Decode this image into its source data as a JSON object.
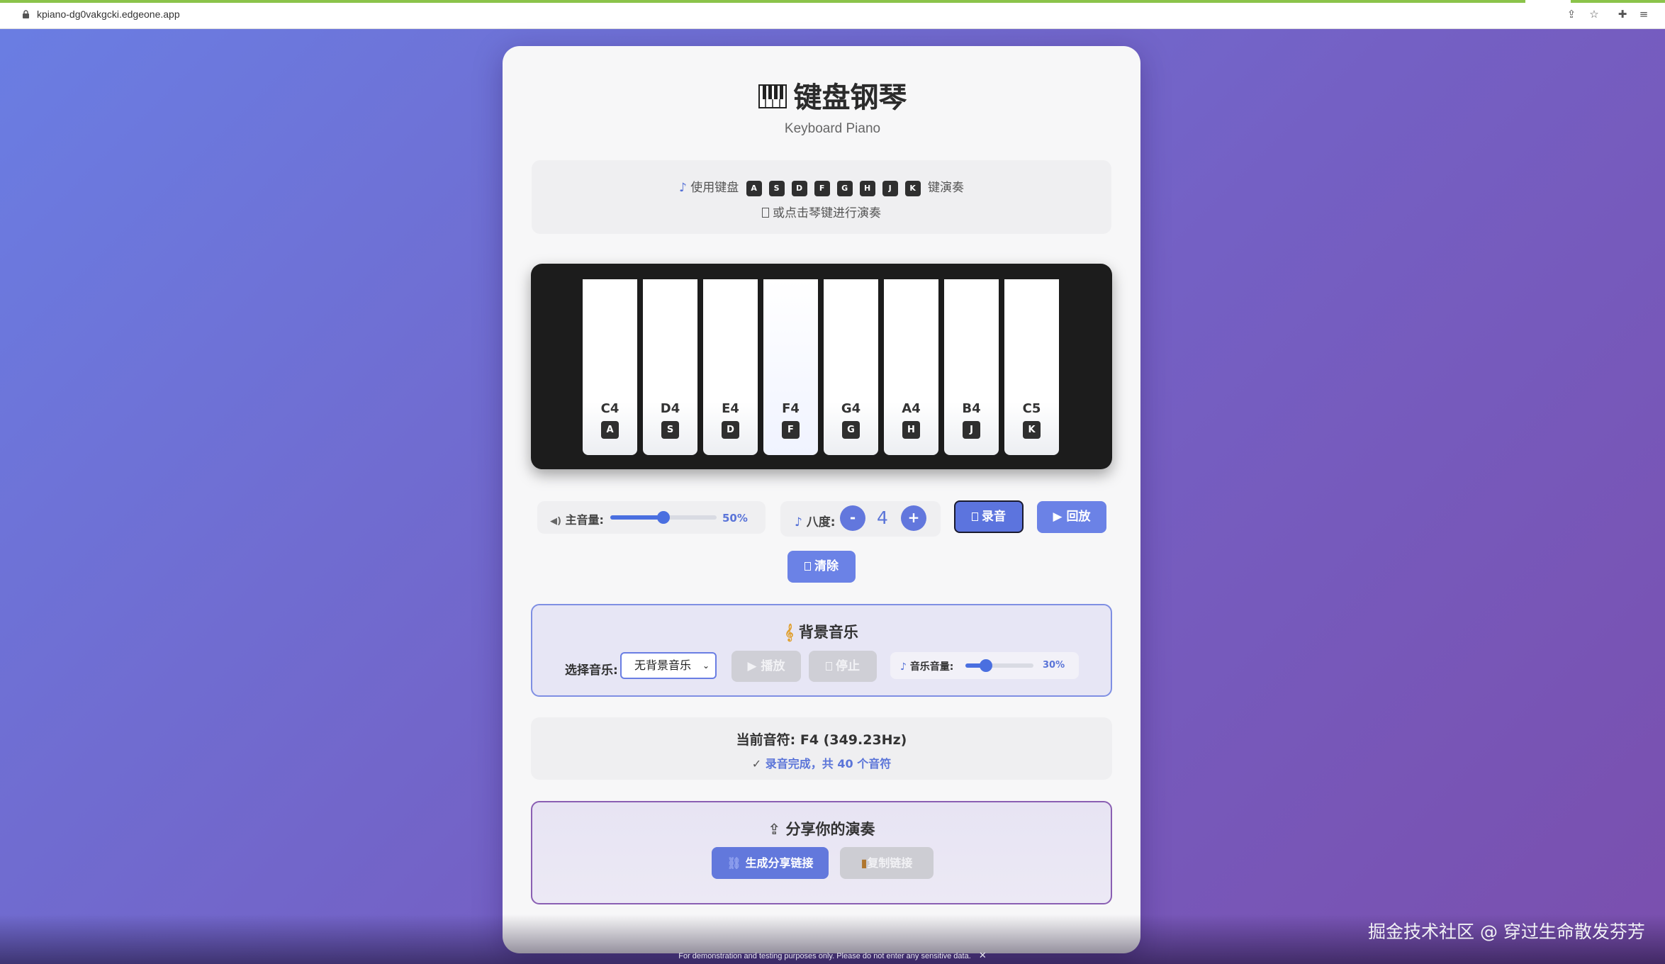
{
  "browser": {
    "url": "kpiano-dg0vakgcki.edgeone.app"
  },
  "header": {
    "title": "键盘钢琴",
    "subtitle": "Keyboard Piano"
  },
  "instructions": {
    "prefix": "使用键盘",
    "keys": [
      "A",
      "S",
      "D",
      "F",
      "G",
      "H",
      "J",
      "K"
    ],
    "suffix": "键演奏",
    "line2": "或点击琴键进行演奏"
  },
  "piano": {
    "keys": [
      {
        "note": "C4",
        "key": "A"
      },
      {
        "note": "D4",
        "key": "S"
      },
      {
        "note": "E4",
        "key": "D"
      },
      {
        "note": "F4",
        "key": "F"
      },
      {
        "note": "G4",
        "key": "G"
      },
      {
        "note": "A4",
        "key": "H"
      },
      {
        "note": "B4",
        "key": "J"
      },
      {
        "note": "C5",
        "key": "K"
      }
    ]
  },
  "controls": {
    "master_volume_label": "主音量:",
    "master_volume_value": "50%",
    "master_volume_fraction": 0.5,
    "octave_label": "八度:",
    "octave_minus": "-",
    "octave_plus": "+",
    "octave_value": "4",
    "record_label": "录音",
    "playback_label": "▶ 回放",
    "clear_label": "清除"
  },
  "bgm": {
    "title": "背景音乐",
    "select_label": "选择音乐:",
    "selected_option": "无背景音乐",
    "play_label": "▶ 播放",
    "stop_label": "停止",
    "volume_label": "音乐音量:",
    "volume_value": "30%",
    "volume_fraction": 0.3
  },
  "status": {
    "current_note": "当前音符: F4 (349.23Hz)",
    "record_status": "录音完成，共 40 个音符"
  },
  "share": {
    "title": "分享你的演奏",
    "generate_label": "生成分享链接",
    "copy_label": "复制链接"
  },
  "footer": {
    "notice": "For demonstration and testing purposes only. Please do not enter any sensitive data.",
    "close": "✕"
  },
  "watermark": "掘金技术社区 @ 穿过生命散发芬芳",
  "colors": {
    "accent": "#5c74de",
    "piano_body": "#1c1c1c",
    "value_text": "#5a74d8"
  }
}
